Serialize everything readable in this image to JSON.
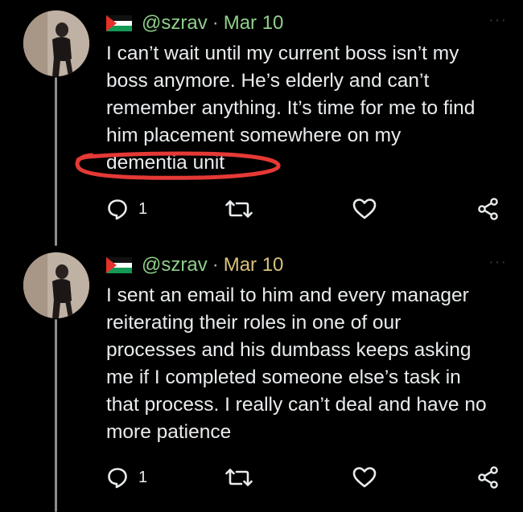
{
  "tweets": [
    {
      "handle": "@szrav",
      "separator": "·",
      "date": "Mar 10",
      "more_label": "···",
      "text": "I can’t wait until my current boss isn’t my\nboss anymore. He’s elderly and can’t\nremember anything. It’s time for me to find\nhim placement somewhere on my\ndementia unit",
      "reply_count": "1",
      "icons": [
        "reply-icon",
        "retweet-icon",
        "like-icon",
        "share-icon"
      ],
      "highlight_color": "#e53935"
    },
    {
      "handle": "@szrav",
      "separator": "·",
      "date": "Mar 10",
      "more_label": "···",
      "text": "I sent an email to him and every manager\nreiterating their roles in one of our\nprocesses and his dumbass keeps asking\nme if I completed someone else’s task in\nthat process. I really can’t deal and have no\nmore patience",
      "reply_count": "1",
      "icons": [
        "reply-icon",
        "retweet-icon",
        "like-icon",
        "share-icon"
      ]
    }
  ],
  "colors": {
    "background": "#000000",
    "text": "#e9ecee",
    "handle": "#8fcf8a",
    "thread_line": "#8a8d91"
  }
}
